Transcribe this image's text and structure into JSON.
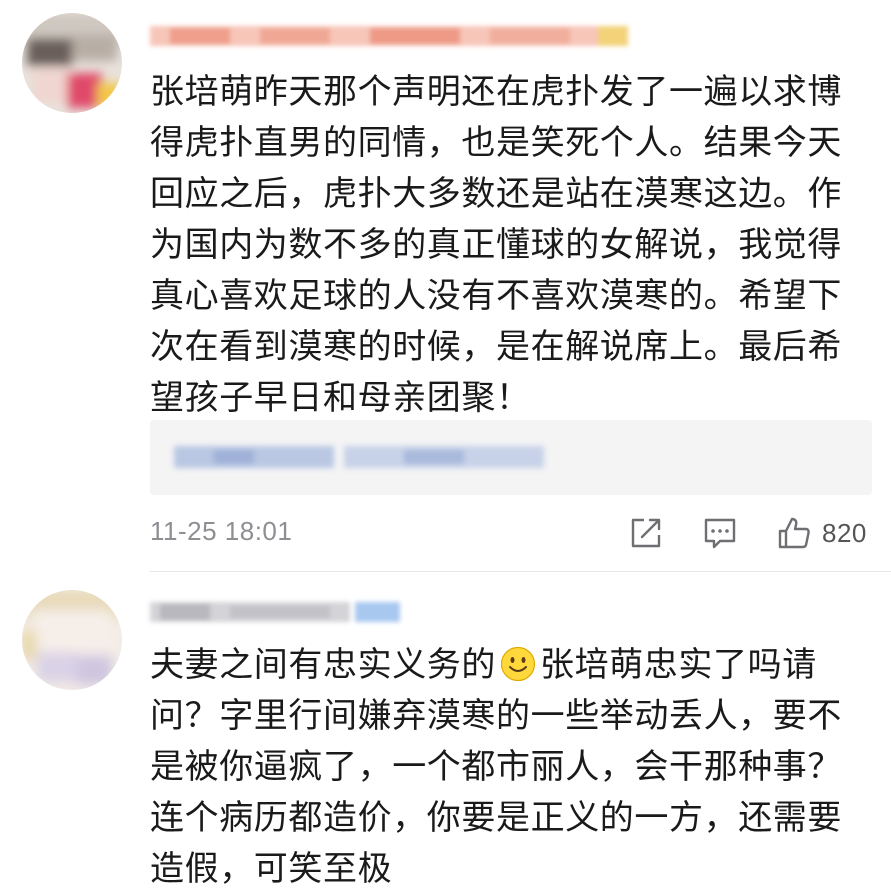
{
  "colors": {
    "text": "#1a1a1a",
    "meta": "#8e8e93",
    "reply_bg": "#f4f4f5",
    "divider": "#e6e6e6"
  },
  "comments": [
    {
      "body": "张培萌昨天那个声明还在虎扑发了一遍以求博得虎扑直男的同情，也是笑死个人。结果今天回应之后，虎扑大多数还是站在漠寒这边。作为国内为数不多的真正懂球的女解说，我觉得真心喜欢足球的人没有不喜欢漠寒的。希望下次在看到漠寒的时候，是在解说席上。最后希望孩子早日和母亲团聚！",
      "timestamp": "11-25 18:01",
      "likes": "820",
      "icons": {
        "share": "share-icon",
        "comment": "comment-icon",
        "like": "thumbs-up-icon"
      }
    },
    {
      "body_before_emoji": "夫妻之间有忠实义务的",
      "emoji": "smiley-face-emoji",
      "body_after_emoji": "张培萌忠实了吗请问？字里行间嫌弃漠寒的一些举动丢人，要不是被你逼疯了，一个都市丽人，会干那种事？连个病历都造价，你要是正义的一方，还需要造假，可笑至极"
    }
  ]
}
